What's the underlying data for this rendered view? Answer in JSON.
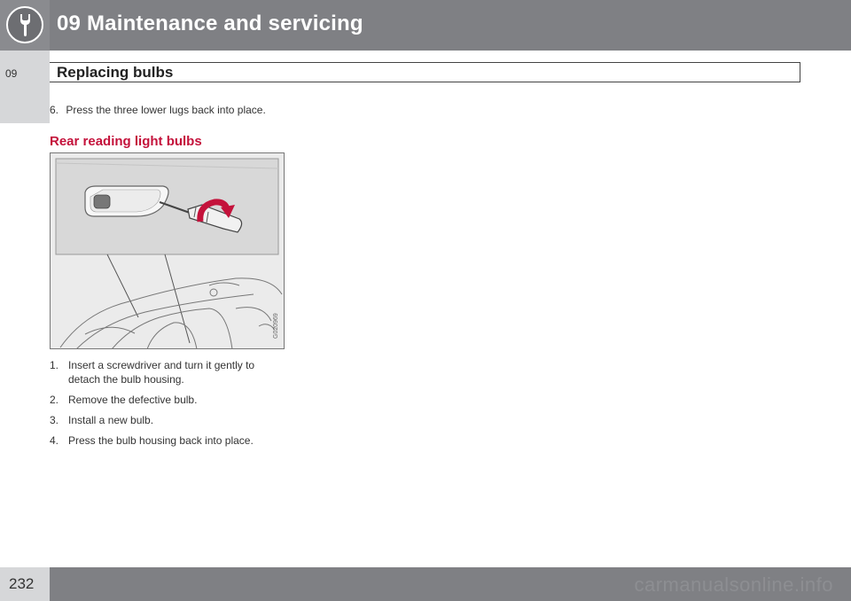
{
  "header": {
    "chapter_title": "09 Maintenance and servicing",
    "logo_icon": "wrench-icon"
  },
  "sidebar": {
    "chapter_number": "09"
  },
  "section": {
    "title": "Replacing bulbs"
  },
  "content": {
    "step6": {
      "number": "6.",
      "text": "Press the three lower lugs back into place."
    },
    "subheading": "Rear reading light bulbs",
    "figure": {
      "code": "G020969"
    },
    "steps": [
      {
        "number": "1.",
        "text": "Insert a screwdriver and turn it gently to detach the bulb housing."
      },
      {
        "number": "2.",
        "text": "Remove the defective bulb."
      },
      {
        "number": "3.",
        "text": "Install a new bulb."
      },
      {
        "number": "4.",
        "text": "Press the bulb housing back into place."
      }
    ]
  },
  "footer": {
    "page_number": "232",
    "watermark": "carmanualsonline.info"
  },
  "colors": {
    "header_bg": "#7f8084",
    "tab_bg": "#d6d7d9",
    "subheading": "#c4123b"
  }
}
